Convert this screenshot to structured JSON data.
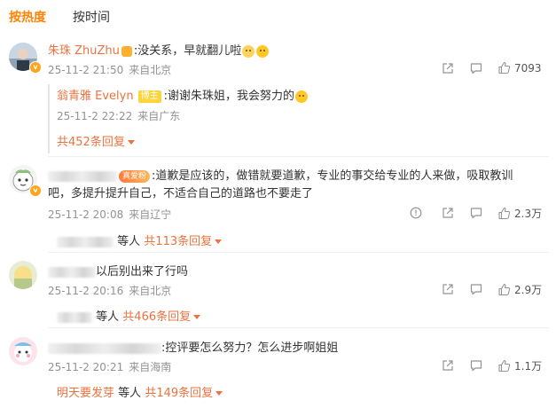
{
  "tabs": {
    "hot": "按热度",
    "time": "按时间"
  },
  "colors": {
    "accent": "#ff8200",
    "username": "#eb7340",
    "meta": "#939393"
  },
  "comments": [
    {
      "username": "朱珠 ZhuZhu",
      "text": ":没关系，早就翻儿啦",
      "date": "25-11-2 21:50",
      "location": "来自北京",
      "likes": "7093",
      "reply": {
        "username": "翁青雅 Evelyn",
        "tag": "博主",
        "text": ":谢谢朱珠姐，我会努力的",
        "date": "25-11-2 22:22",
        "location": "来自广东"
      },
      "more": "共452条回复"
    },
    {
      "fan_tag": "真爱粉",
      "text_line1": ":道歉是应该的，做错就要道歉，专业的事交给专业的人来做，吸取教训",
      "text_line2": "吧，多提升提升自己，不适合自己的道路也不要走了",
      "date": "25-11-2 20:08",
      "location": "来自辽宁",
      "likes": "2.3万",
      "more_prefix": "等人",
      "more": "共113条回复"
    },
    {
      "text": "以后别出来了行吗",
      "date": "25-11-2 20:16",
      "location": "来自北京",
      "likes": "2.9万",
      "more_prefix": "等人",
      "more": "共466条回复"
    },
    {
      "text": ":控评要怎么努力？怎么进步啊姐姐",
      "date": "25-11-2 20:21",
      "location": "来自海南",
      "likes": "1.1万",
      "more_user": "明天要发芽",
      "more_prefix": "等人",
      "more": "共149条回复"
    }
  ],
  "icons": [
    "share-icon",
    "comment-icon",
    "like-icon",
    "report-icon",
    "caret-down-icon",
    "verified-badge-icon"
  ]
}
